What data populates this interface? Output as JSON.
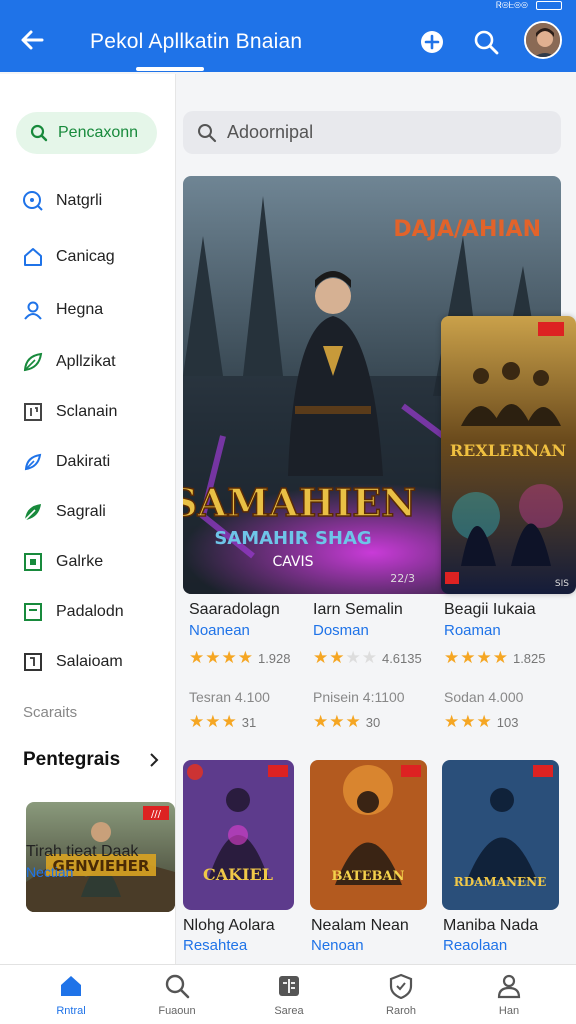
{
  "header": {
    "title": "Pekol Apllkatin Bnaian",
    "status_text": "Ꮢ⊚ᖶ⊚⊚"
  },
  "sidebar": {
    "search_label": "Pencaxonn",
    "items": [
      {
        "label": "Natgrli",
        "icon": "compass-icon"
      },
      {
        "label": "Canicag",
        "icon": "home-icon"
      },
      {
        "label": "Hegna",
        "icon": "person-icon"
      },
      {
        "label": "Apllzikat",
        "icon": "leaf-icon"
      },
      {
        "label": "Sclanain",
        "icon": "grid-icon"
      },
      {
        "label": "Dakirati",
        "icon": "feather-icon"
      },
      {
        "label": "Sagrali",
        "icon": "leaf2-icon"
      },
      {
        "label": "Galrke",
        "icon": "box-icon"
      },
      {
        "label": "Padalodn",
        "icon": "square-icon"
      },
      {
        "label": "Salaioam",
        "icon": "frame-icon"
      }
    ],
    "section_label": "Scaraits",
    "section_title": "Pentegrais",
    "card": {
      "title": "Tirah tieat Daak",
      "subtitle": "Nectian",
      "badge": "///"
    }
  },
  "main": {
    "search_placeholder": "Adoornipal",
    "hero": {
      "logo": "DAJA/AHIAN",
      "title_art": "SAMAHIEN",
      "subtitle_art": "SAMAHIR SHAG",
      "tag_art": "CAVIS",
      "corner": "22/3"
    },
    "card2": {
      "title_art": "REXLERNAN",
      "corner": "SIS"
    },
    "row1": [
      {
        "title": "Saaradolagn",
        "subtitle": "Noanean",
        "rating": "1.928",
        "price": "Tesran 4.100",
        "mini": "31"
      },
      {
        "title": "Iarn Semalin",
        "subtitle": "Dosman",
        "rating": "4.6135",
        "price": "Pnisein 4:1100",
        "mini": "30"
      },
      {
        "title": "Beagii Iukaia",
        "subtitle": "Roaman",
        "rating": "1.825",
        "price": "Sodan 4.000",
        "mini": "103"
      }
    ],
    "thumbs": [
      {
        "art": "CAKIEL",
        "color": "#5d3b8c"
      },
      {
        "art": "BATEBAN",
        "color": "#b35a1f"
      },
      {
        "art": "RDAMANENE",
        "color": "#2a4f7a"
      }
    ],
    "row2": [
      {
        "title": "Nlohg Aolara",
        "subtitle": "Resahtea"
      },
      {
        "title": "Nealam Nean",
        "subtitle": "Nenoan"
      },
      {
        "title": "Maniba Nada",
        "subtitle": "Reaolaan"
      }
    ]
  },
  "bottom_nav": [
    {
      "label": "Rntral",
      "icon": "home-icon",
      "active": true
    },
    {
      "label": "Fuaoun",
      "icon": "search-icon",
      "active": false
    },
    {
      "label": "Sarea",
      "icon": "apps-icon",
      "active": false
    },
    {
      "label": "Raroh",
      "icon": "shield-icon",
      "active": false
    },
    {
      "label": "Han",
      "icon": "person-icon",
      "active": false
    }
  ],
  "colors": {
    "primary": "#1f73e8",
    "accent_green": "#188a3c",
    "star": "#f5a623"
  }
}
